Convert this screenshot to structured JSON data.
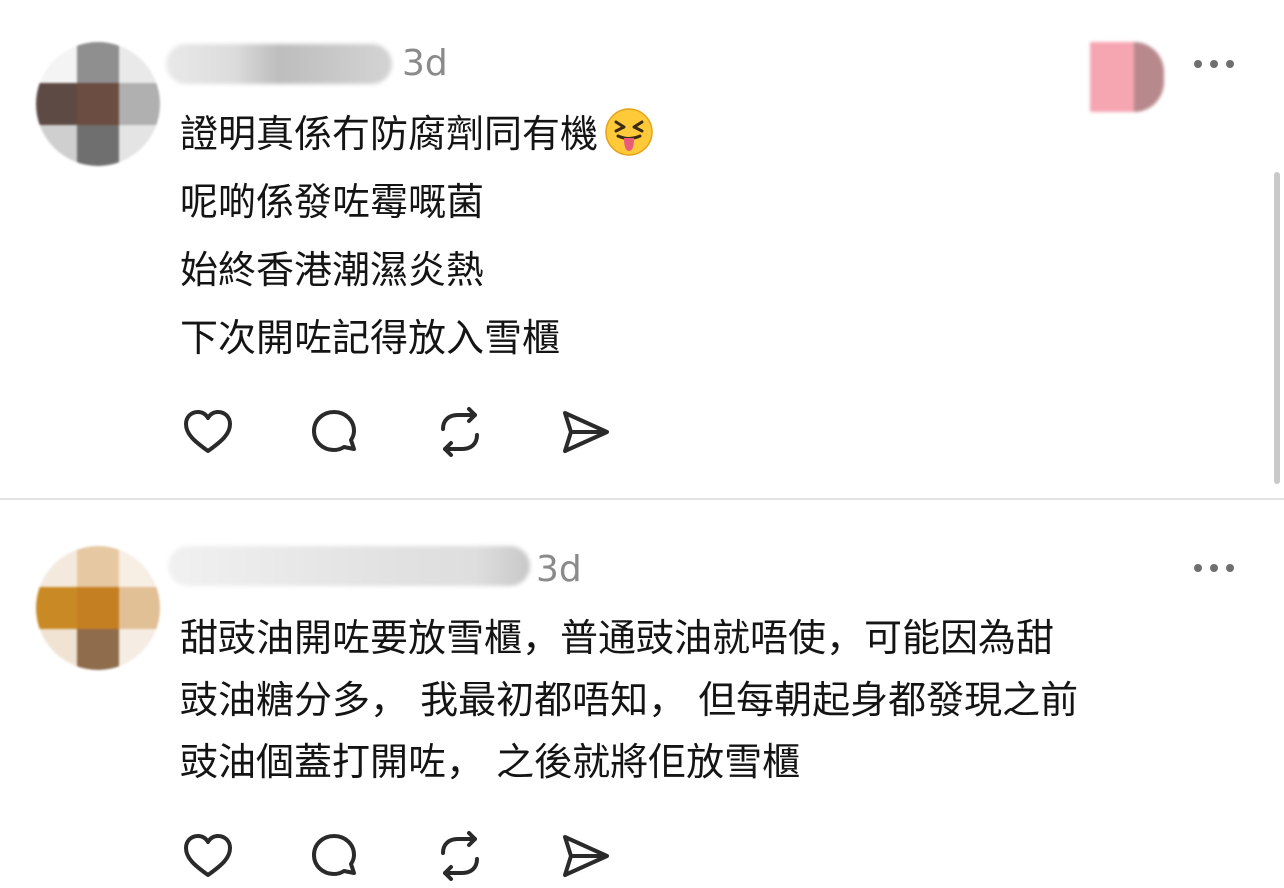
{
  "comments": [
    {
      "timestamp": "3d",
      "lines": [
        "證明真係冇防腐劑同有機",
        "呢啲係發咗霉嘅菌",
        "始終香港潮濕炎熱",
        "下次開咗記得放入雪櫃"
      ],
      "emoji": "😝",
      "avatar_colors": [
        "#f4f4f4",
        "#8f8f8f",
        "#e9e9e9",
        "#5d4a44",
        "#6b4d42",
        "#b0b0b0",
        "#cfcfcf",
        "#6f6f6f",
        "#e4e4e4"
      ]
    },
    {
      "timestamp": "3d",
      "lines": [
        "甜豉油開咗要放雪櫃，普通豉油就唔使，可能因為甜",
        "豉油糖分多， 我最初都唔知， 但每朝起身都發現之前",
        "豉油個蓋打開咗， 之後就將佢放雪櫃"
      ],
      "avatar_colors": [
        "#f3e9dc",
        "#e6c9a2",
        "#f7eee4",
        "#c98a25",
        "#c47f22",
        "#e2c095",
        "#f0e3d3",
        "#8e6c4c",
        "#f5ede3"
      ]
    }
  ],
  "icons": {
    "like": "heart-icon",
    "reply": "comment-bubble-icon",
    "repost": "repost-icon",
    "share": "send-icon",
    "more": "more-horizontal-icon"
  },
  "colors": {
    "text": "#141414",
    "muted": "#8a8a8a",
    "icon": "#2a2a2a",
    "divider": "#e3e3e3"
  }
}
